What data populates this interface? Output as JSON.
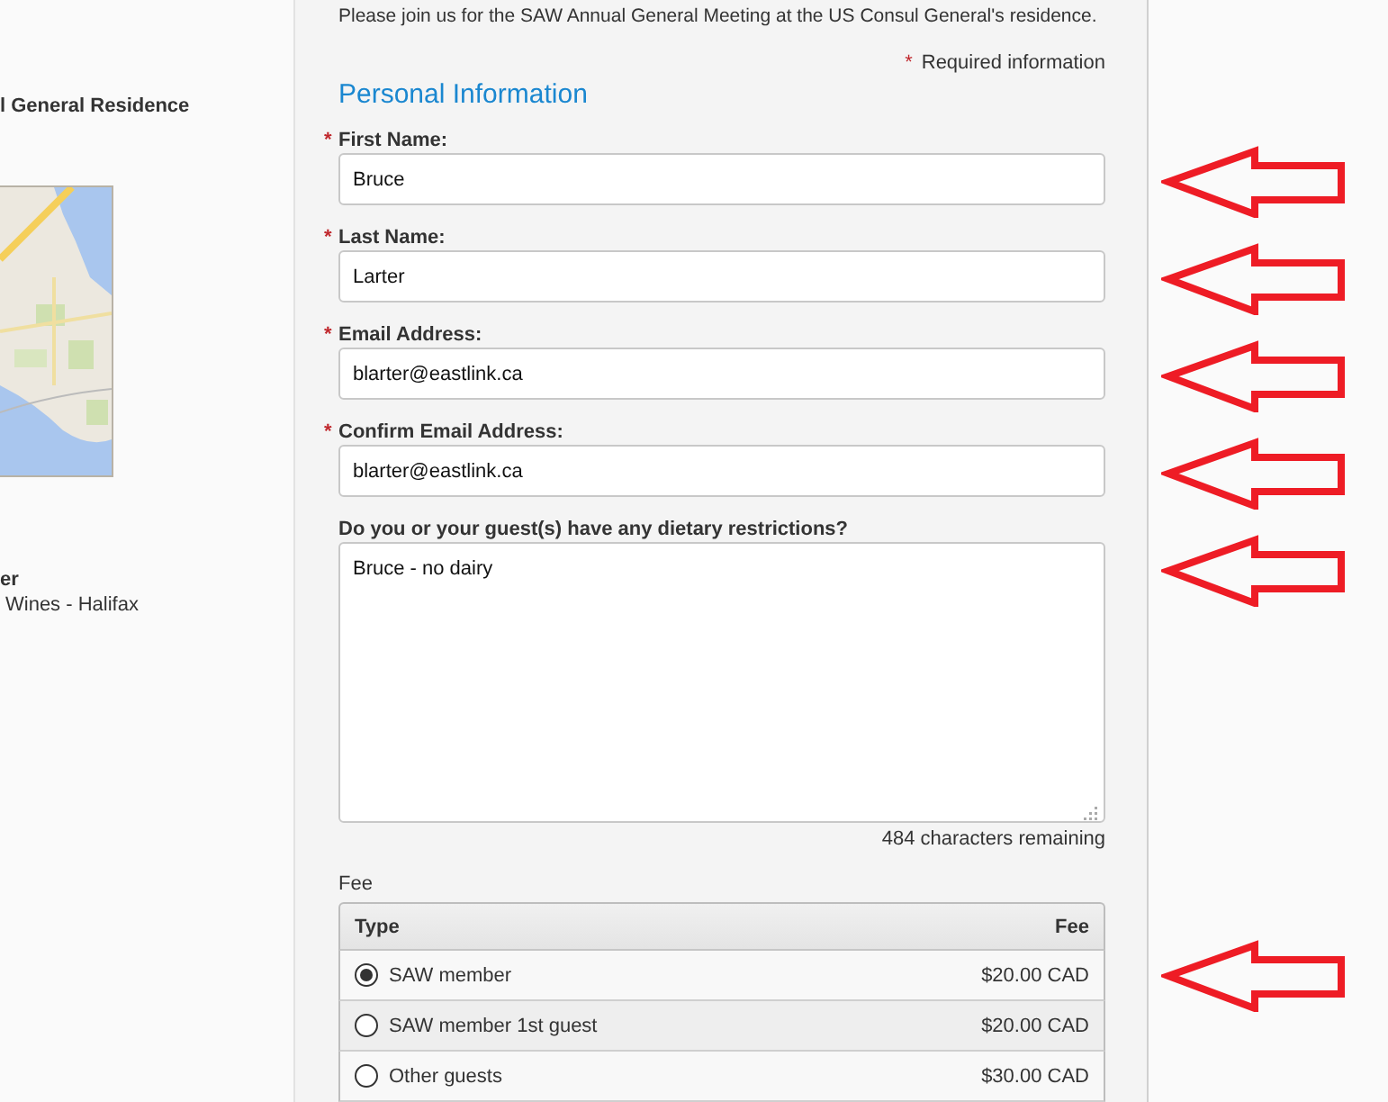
{
  "sidebar": {
    "venue_name": "l General Residence",
    "sponsor_title": "er",
    "sponsor_name": "Wines - Halifax"
  },
  "form": {
    "intro": "Please join us for the SAW Annual General Meeting at the US Consul General's residence.",
    "required_marker": "*",
    "required_note": "Required information",
    "section_title": "Personal Information",
    "fields": [
      {
        "kind": "input",
        "label": "First Name:",
        "required": true,
        "value": "Bruce",
        "arrow": true
      },
      {
        "kind": "input",
        "label": "Last Name:",
        "required": true,
        "value": "Larter",
        "arrow": true
      },
      {
        "kind": "input",
        "label": "Email Address:",
        "required": true,
        "value": "blarter@eastlink.ca",
        "arrow": true
      },
      {
        "kind": "input",
        "label": "Confirm Email Address:",
        "required": true,
        "value": "blarter@eastlink.ca",
        "arrow": true
      },
      {
        "kind": "textarea",
        "label": "Do you or your guest(s) have any dietary restrictions?",
        "required": false,
        "value": "Bruce - no dairy",
        "counter": "484 characters remaining",
        "arrow": true
      }
    ],
    "fee": {
      "label": "Fee",
      "columns": [
        "Type",
        "Fee"
      ],
      "rows": [
        {
          "type": "SAW member",
          "fee": "$20.00 CAD",
          "selected": true,
          "arrow": true
        },
        {
          "type": "SAW member 1st guest",
          "fee": "$20.00 CAD",
          "selected": false,
          "arrow": false
        },
        {
          "type": "Other guests",
          "fee": "$30.00 CAD",
          "selected": false,
          "arrow": false
        }
      ]
    }
  }
}
